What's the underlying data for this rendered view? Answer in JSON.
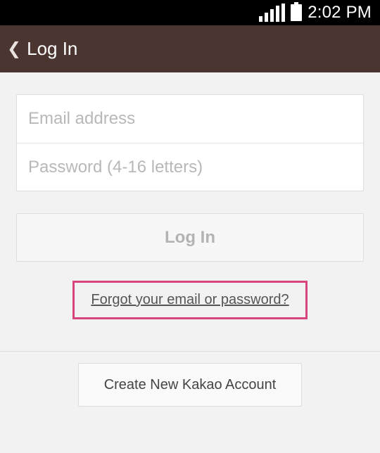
{
  "status_bar": {
    "time": "2:02 PM"
  },
  "header": {
    "back_icon": "chevron-left-icon",
    "title": "Log In"
  },
  "form": {
    "email_placeholder": "Email address",
    "email_value": "",
    "password_placeholder": "Password (4-16 letters)",
    "password_value": ""
  },
  "actions": {
    "login_label": "Log In",
    "forgot_label": "Forgot your email or password?",
    "create_account_label": "Create New Kakao Account"
  },
  "colors": {
    "app_bar": "#4b3531",
    "highlight": "#d6457e",
    "background": "#f2f2f2"
  }
}
